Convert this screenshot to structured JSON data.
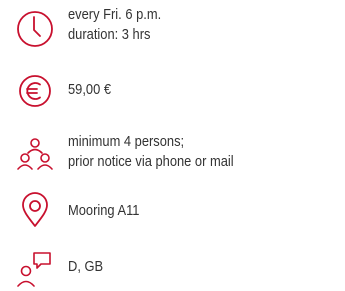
{
  "accent_color": "#c8102e",
  "items": [
    {
      "icon": "clock-icon",
      "lines": [
        "every Fri. 6 p.m.",
        "duration: 3 hrs"
      ]
    },
    {
      "icon": "euro-icon",
      "lines": [
        "59,00 €"
      ]
    },
    {
      "icon": "group-icon",
      "lines": [
        "minimum 4 persons;",
        "prior notice via phone or mail"
      ]
    },
    {
      "icon": "location-pin-icon",
      "lines": [
        "Mooring A11"
      ]
    },
    {
      "icon": "speech-person-icon",
      "lines": [
        "D, GB"
      ]
    }
  ]
}
